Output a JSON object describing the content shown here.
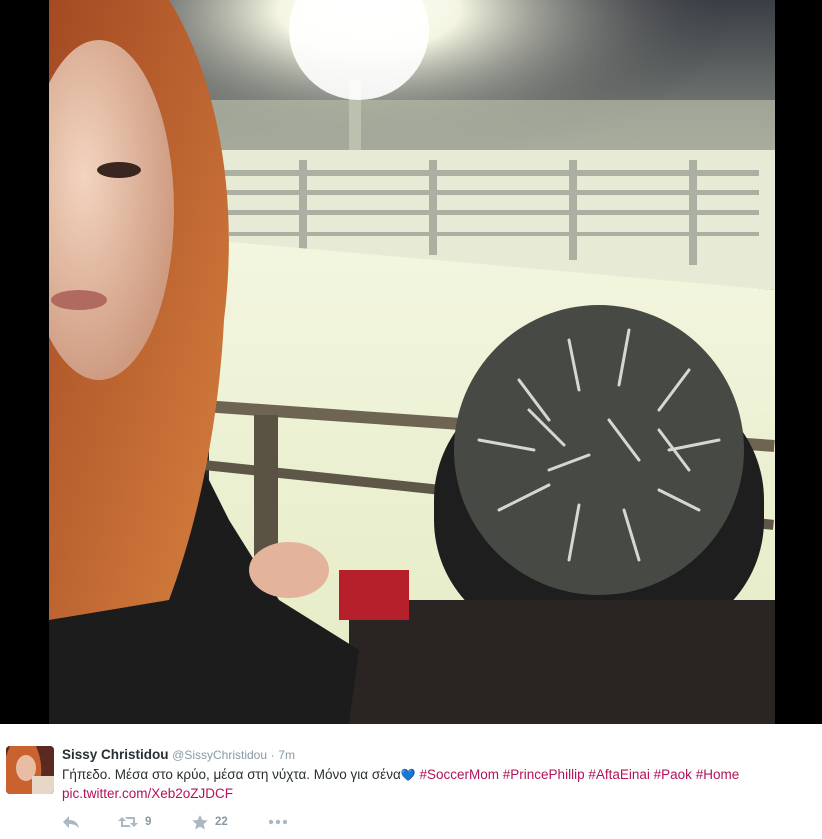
{
  "photo": {
    "subject": "stadium-selfie"
  },
  "tweet": {
    "display_name": "Sissy Christidou",
    "handle": "@SissyChristidou",
    "separator": "·",
    "time": "7m",
    "text_plain": "Γήπεδο. Μέσα στο κρύο, μέσα στη νύχτα. Μόνο για σένα",
    "emoji": "💙",
    "hashtags": [
      "#SoccerMom",
      "#PrincePhillip",
      "#AftaEinai",
      "#Paok",
      "#Home"
    ],
    "pic_link": "pic.twitter.com/Xeb2oZJDCF",
    "retweet_count": "9",
    "favorite_count": "22"
  },
  "colors": {
    "link": "#b3125a",
    "name": "#292f33",
    "meta": "#8899a6",
    "icon": "#aab8c2"
  },
  "icons": {
    "reply": "reply-icon",
    "retweet": "retweet-icon",
    "favorite": "star-icon",
    "more": "more-icon"
  }
}
